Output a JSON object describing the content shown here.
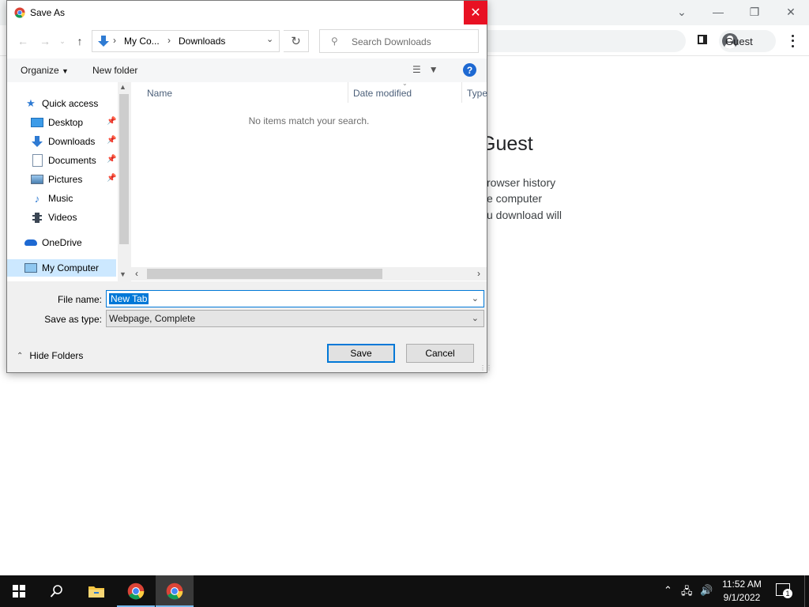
{
  "browser": {
    "profile_label": "Guest",
    "content_heading": "Guest",
    "content_lines": [
      "rowser history",
      "e computer",
      "u download will"
    ]
  },
  "dialog": {
    "title": "Save As",
    "address": {
      "segments": [
        "My Co...",
        "Downloads"
      ]
    },
    "search_placeholder": "Search Downloads",
    "commands": {
      "organize": "Organize",
      "new_folder": "New folder"
    },
    "nav_items": [
      {
        "label": "Quick access",
        "icon": "star-icon"
      },
      {
        "label": "Desktop",
        "icon": "desktop-icon",
        "pinned": true
      },
      {
        "label": "Downloads",
        "icon": "download-arrow-icon",
        "pinned": true
      },
      {
        "label": "Documents",
        "icon": "document-icon",
        "pinned": true
      },
      {
        "label": "Pictures",
        "icon": "pictures-icon",
        "pinned": true
      },
      {
        "label": "Music",
        "icon": "music-note-icon"
      },
      {
        "label": "Videos",
        "icon": "film-icon"
      },
      {
        "label": "OneDrive",
        "icon": "cloud-icon"
      },
      {
        "label": "My Computer",
        "icon": "computer-icon",
        "selected": true
      }
    ],
    "columns": [
      "Name",
      "Date modified",
      "Type"
    ],
    "empty_message": "No items match your search.",
    "file_name_label": "File name:",
    "file_name_value": "New Tab",
    "save_type_label": "Save as type:",
    "save_type_value": "Webpage, Complete",
    "hide_folders_label": "Hide Folders",
    "save_button": "Save",
    "cancel_button": "Cancel"
  },
  "taskbar": {
    "time": "11:52 AM",
    "date": "9/1/2022",
    "notification_count": "1"
  },
  "colors": {
    "accent": "#0078d7",
    "close_red": "#e81123",
    "selected_nav": "#cce8ff",
    "taskbar": "#101010"
  }
}
